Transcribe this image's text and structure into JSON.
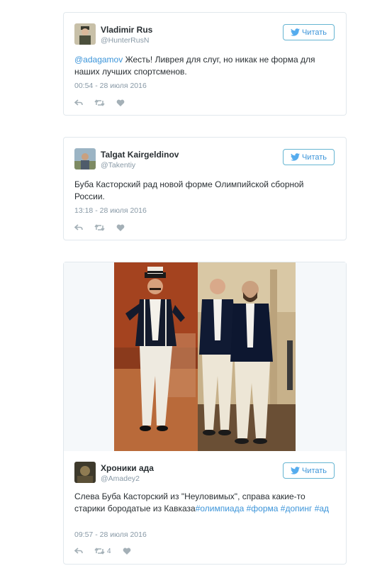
{
  "colors": {
    "link": "#3b94d9",
    "muted": "#8899a6",
    "border": "#e1e8ed",
    "text": "#292f33"
  },
  "tweets": [
    {
      "name": "Vladimir Rus",
      "handle": "@HunterRusN",
      "follow_label": "Читать",
      "mention": "@adagamov",
      "text": " Жесть! Ливрея для слуг, но никак не форма для наших лучших спортсменов.",
      "time": "00:54 - 28 июля 2016",
      "reply_icon": "reply-icon",
      "retweet_icon": "retweet-icon",
      "like_icon": "heart-icon"
    },
    {
      "name": "Talgat Kairgeldinov",
      "handle": "@Takentiy",
      "follow_label": "Читать",
      "text": "Буба Касторский рад новой форме Олимпийской сборной России.",
      "time": "13:18 - 28 июля 2016"
    },
    {
      "name": "Хроники ада",
      "handle": "@Amadey2",
      "follow_label": "Читать",
      "text": "Слева Буба Касторский из \"Неуловимых\", справа какие-то старики бородатые из Кавказа",
      "hashtags": [
        "#олимпиада",
        "#форма",
        "#допинг",
        "#ад"
      ],
      "time": "09:57 - 28 июля 2016",
      "retweet_count": "4"
    }
  ]
}
